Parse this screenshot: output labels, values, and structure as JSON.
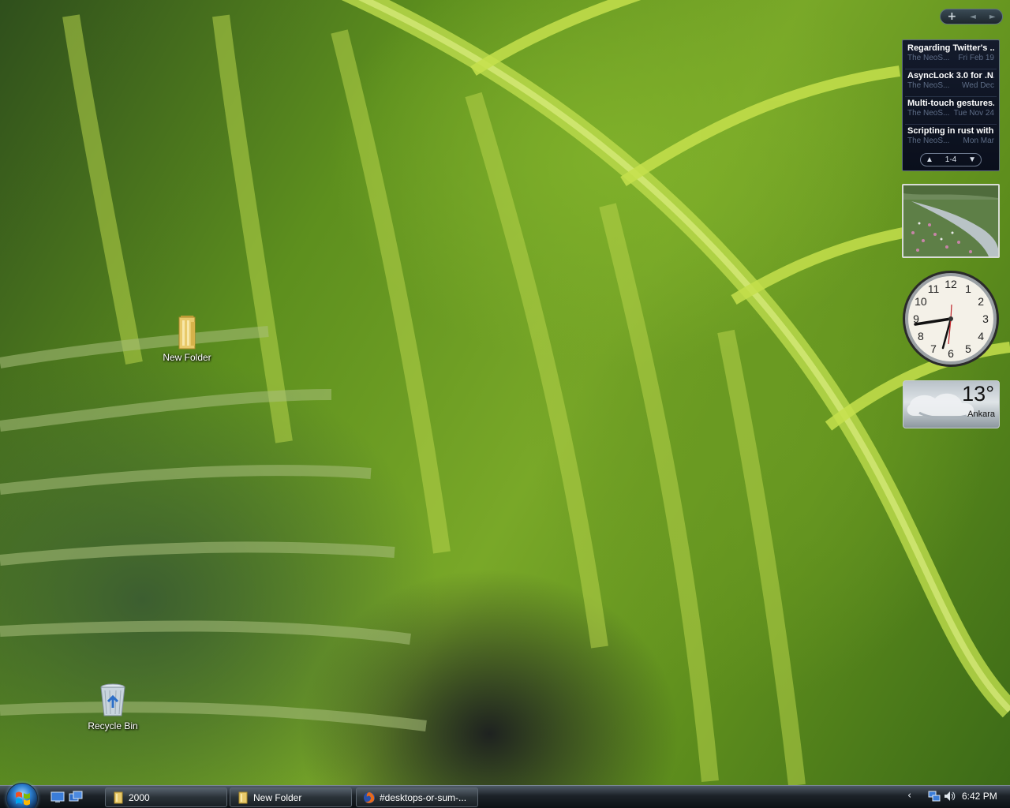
{
  "desktop": {
    "icons": [
      {
        "label": "New Folder",
        "icon": "folder-icon"
      },
      {
        "label": "Recycle Bin",
        "icon": "recycle-bin-icon"
      }
    ]
  },
  "sidebar": {
    "controls": {
      "add": "+",
      "prev": "◄",
      "next": "►"
    },
    "feed": {
      "items": [
        {
          "title": "Regarding Twitter's ...",
          "source": "The NeoS...",
          "date": "Fri Feb 19"
        },
        {
          "title": "AsyncLock 3.0 for .N...",
          "source": "The NeoS...",
          "date": "Wed Dec"
        },
        {
          "title": "Multi-touch gestures...",
          "source": "The NeoS...",
          "date": "Tue Nov 24"
        },
        {
          "title": "Scripting in rust with...",
          "source": "The NeoS...",
          "date": "Mon Mar"
        }
      ],
      "pager": {
        "range": "1-4",
        "up": "▲",
        "down": "▼"
      }
    },
    "clock": {
      "numerals": [
        "12",
        "1",
        "2",
        "3",
        "4",
        "5",
        "6",
        "7",
        "8",
        "9",
        "10",
        "11"
      ]
    },
    "weather": {
      "temperature": "13°",
      "city": "Ankara"
    }
  },
  "taskbar": {
    "tasks": [
      {
        "label": "2000",
        "icon": "folder-icon"
      },
      {
        "label": "New Folder",
        "icon": "folder-icon"
      },
      {
        "label": "#desktops-or-sum-...",
        "icon": "firefox-icon"
      }
    ],
    "tray": {
      "chevron": "‹",
      "time": "6:42 PM"
    }
  },
  "colors": {
    "leaf_light": "#c8e64a",
    "leaf_dark": "#4a7a1c",
    "taskbar": "#1c2228",
    "feed_bg": "#0a0f1c"
  }
}
